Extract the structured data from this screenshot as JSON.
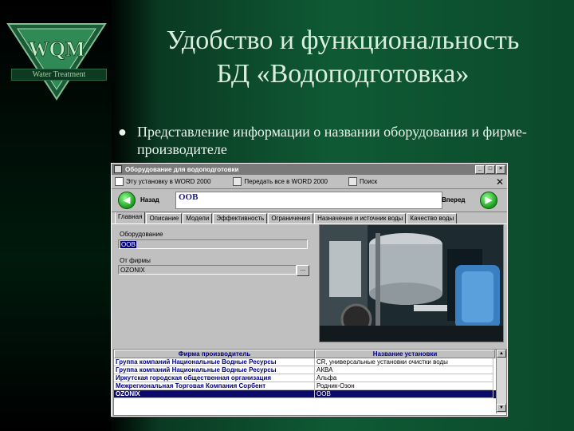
{
  "slide": {
    "title_line1": "Удобство и функциональность",
    "title_line2": "БД «Водоподготовка»",
    "bullet": "Представление информации о названии оборудования и фирме-производителе",
    "logo_text": "Water Treatment"
  },
  "window": {
    "title": "Оборудование для водоподготовки",
    "toolbar": {
      "export_one": "Эту установку в WORD 2000",
      "export_all": "Передать все в WORD 2000",
      "search": "Поиск"
    },
    "nav": {
      "back": "Назад",
      "forward": "Вперед",
      "current": "OOB"
    },
    "tabs": [
      "Главная",
      "Описание",
      "Модели",
      "Эффективность",
      "Ограничения",
      "Назначение и источник воды",
      "Качество воды"
    ],
    "form": {
      "equipment_label": "Оборудование",
      "equipment_value": "OOB",
      "firm_label": "От фирмы",
      "firm_value": "OZONIX",
      "browse_label": "..."
    },
    "grid": {
      "headers": [
        "Фирма производитель",
        "Название установки"
      ],
      "rows": [
        [
          "Группа компаний Национальные Водные Ресурсы",
          "CR, универсальные установки очистки воды"
        ],
        [
          "Группа компаний Национальные Водные Ресурсы",
          "АКВА"
        ],
        [
          "Иркутская городская общественная организация",
          "Альфа"
        ],
        [
          "Межрегиональная Торговая Компания Сорбент",
          "Родник-Озон"
        ],
        [
          "OZONIX",
          "OOB"
        ]
      ],
      "selected_row": 4
    }
  }
}
